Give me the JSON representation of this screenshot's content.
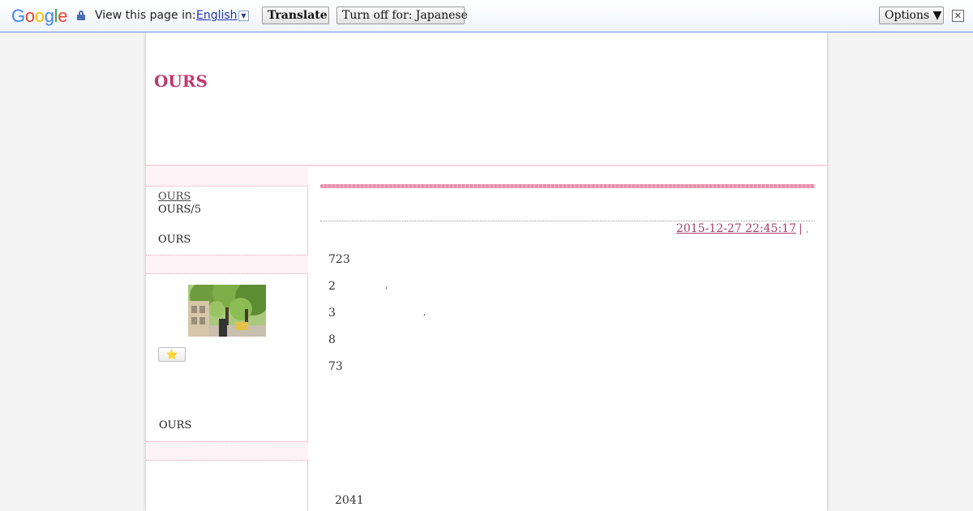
{
  "translate_bar": {
    "logo": [
      "G",
      "o",
      "o",
      "g",
      "l",
      "e"
    ],
    "logo_colors": [
      "#4285f4",
      "#ea4335",
      "#fbbc05",
      "#4285f4",
      "#34a853",
      "#ea4335"
    ],
    "view_text": "View this page in:",
    "language": "English",
    "translate_label": "Translate",
    "turn_off_label": "Turn off for: Japanese",
    "options_label": "Options ▼",
    "close_label": "✕"
  },
  "site": {
    "title": "OURS",
    "accent": "#c0386d"
  },
  "sidebar": {
    "link": "OURS",
    "item1": "OURS/5",
    "item2": "OURS",
    "star": "⭐",
    "footer_item": "OURS"
  },
  "post": {
    "date": "2015-12-27 22:45:17",
    "separator": "|",
    "separator_after": ",",
    "lines": [
      "723",
      "2",
      "3",
      "8",
      "73"
    ],
    "comma": ",",
    "footer_number": "2041"
  }
}
